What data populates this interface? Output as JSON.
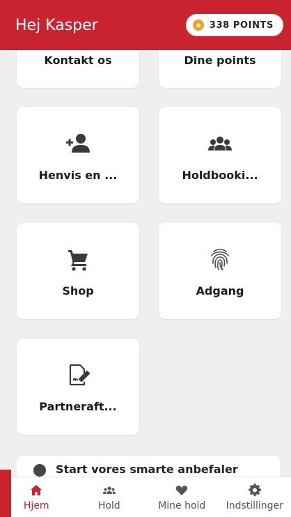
{
  "header": {
    "greeting": "Hej Kasper",
    "points_label": "338 POINTS",
    "bg_color": "#c8232f"
  },
  "tiles": [
    {
      "label": "Kontakt os",
      "icon": "contact-icon"
    },
    {
      "label": "Dine points",
      "icon": "points-icon"
    },
    {
      "label": "Henvis en ...",
      "icon": "add-person-icon"
    },
    {
      "label": "Holdbooki...",
      "icon": "group-icon"
    },
    {
      "label": "Shop",
      "icon": "cart-icon"
    },
    {
      "label": "Adgang",
      "icon": "fingerprint-icon"
    },
    {
      "label": "Partneraft...",
      "icon": "signature-document-icon"
    }
  ],
  "partial_card": {
    "text": "Start vores smarte anbefaler"
  },
  "tabbar": {
    "items": [
      {
        "label": "Hjem",
        "icon": "home-icon",
        "active": true
      },
      {
        "label": "Hold",
        "icon": "group-icon",
        "active": false
      },
      {
        "label": "Mine hold",
        "icon": "heart-icon",
        "active": false
      },
      {
        "label": "Indstillinger",
        "icon": "gear-icon",
        "active": false
      }
    ],
    "active_color": "#c8232f"
  }
}
